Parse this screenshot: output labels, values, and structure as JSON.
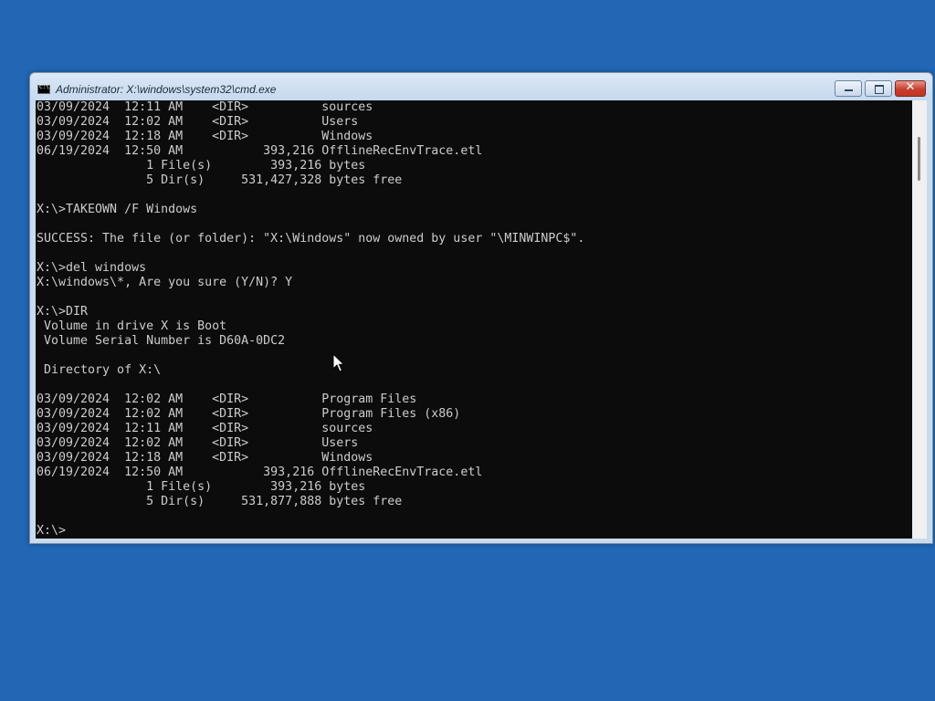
{
  "window": {
    "title": "Administrator: X:\\windows\\system32\\cmd.exe",
    "icon": "cmd-icon",
    "controls": {
      "minimize": "minimize-icon",
      "maximize": "maximize-icon",
      "close": "close-icon",
      "close_glyph": "✕"
    }
  },
  "console": {
    "lines": [
      "03/09/2024  12:11 AM    <DIR>          sources",
      "03/09/2024  12:02 AM    <DIR>          Users",
      "03/09/2024  12:18 AM    <DIR>          Windows",
      "06/19/2024  12:50 AM           393,216 OfflineRecEnvTrace.etl",
      "               1 File(s)        393,216 bytes",
      "               5 Dir(s)     531,427,328 bytes free",
      "",
      "X:\\>TAKEOWN /F Windows",
      "",
      "SUCCESS: The file (or folder): \"X:\\Windows\" now owned by user \"\\MINWINPC$\".",
      "",
      "X:\\>del windows",
      "X:\\windows\\*, Are you sure (Y/N)? Y",
      "",
      "X:\\>DIR",
      " Volume in drive X is Boot",
      " Volume Serial Number is D60A-0DC2",
      "",
      " Directory of X:\\",
      "",
      "03/09/2024  12:02 AM    <DIR>          Program Files",
      "03/09/2024  12:02 AM    <DIR>          Program Files (x86)",
      "03/09/2024  12:11 AM    <DIR>          sources",
      "03/09/2024  12:02 AM    <DIR>          Users",
      "03/09/2024  12:18 AM    <DIR>          Windows",
      "06/19/2024  12:50 AM           393,216 OfflineRecEnvTrace.etl",
      "               1 File(s)        393,216 bytes",
      "               5 Dir(s)     531,877,888 bytes free",
      "",
      "X:\\>"
    ]
  },
  "colors": {
    "desktop": "#2167b4",
    "console_bg": "#0c0c0c",
    "console_fg": "#cccccc"
  }
}
